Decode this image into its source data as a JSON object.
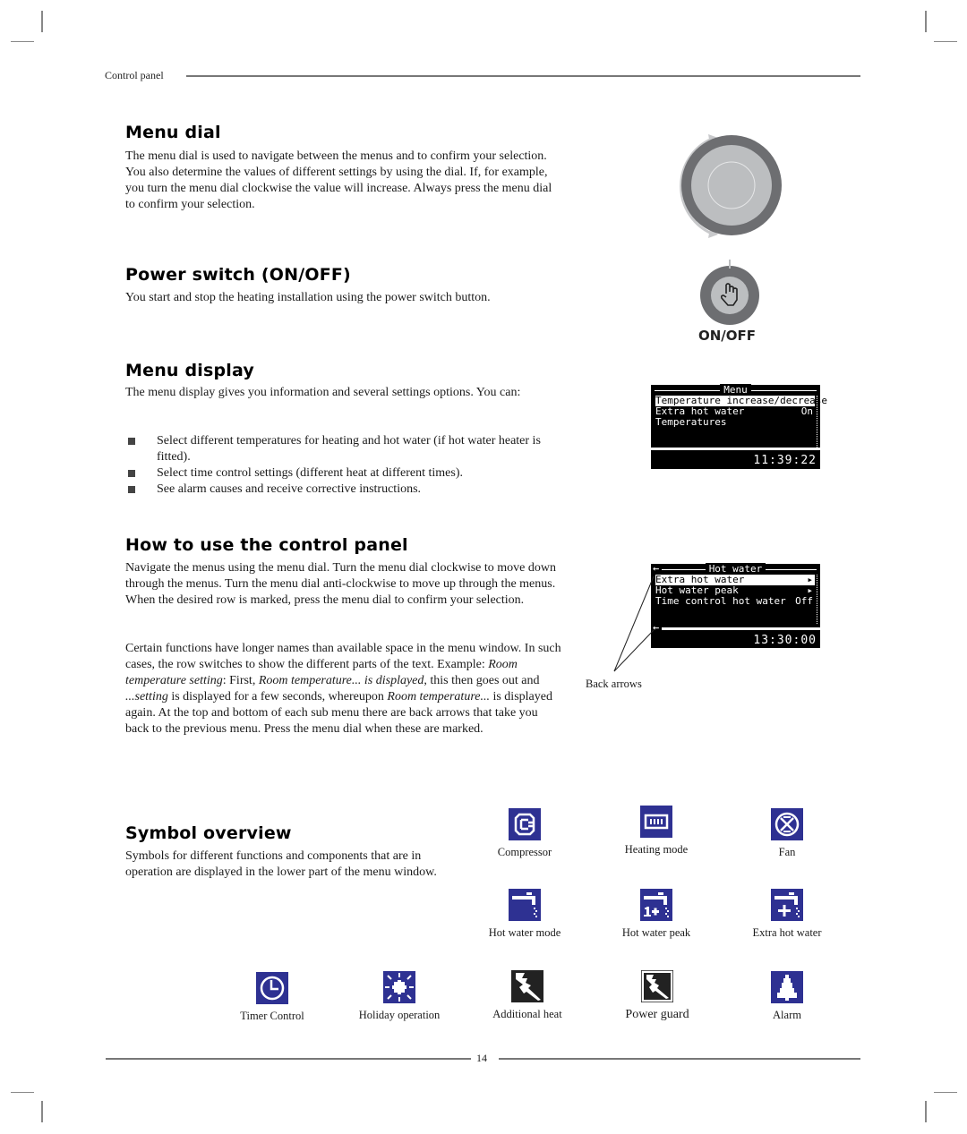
{
  "header": {
    "section": "Control panel"
  },
  "sections": {
    "menu_dial": {
      "title": "Menu dial",
      "body": "The menu dial is used to navigate between the menus and to confirm your selection. You also determine the values of different settings by using the dial. If, for example, you turn the menu dial clockwise the value will increase. Always press the menu dial to confirm your selection."
    },
    "power_switch": {
      "title": "Power switch (ON/OFF)",
      "body": "You start and stop the heating installation using the power switch button.",
      "button_label": "ON/OFF"
    },
    "menu_display": {
      "title": "Menu display",
      "body": "The menu display gives you information and several settings options. You can:",
      "bullets": [
        "Select different temperatures for heating and hot water (if hot water heater is fitted).",
        "Select time control settings (different heat at different times).",
        "See alarm causes and receive corrective instructions."
      ],
      "screen": {
        "title": "Menu",
        "rows": [
          {
            "label": "Temperature increase/decrease",
            "value": "",
            "selected": true
          },
          {
            "label": "Extra hot water",
            "value": "On",
            "selected": false
          },
          {
            "label": "Temperatures",
            "value": "",
            "selected": false
          }
        ],
        "time": "11:39:22"
      }
    },
    "how_to_use": {
      "title": "How to use the control panel",
      "para1": "Navigate the menus using the menu dial. Turn the menu dial clockwise to move down through the menus. Turn the menu dial anti-clockwise to move up through the menus. When the desired row is marked, press the menu dial to confirm your selection.",
      "para2_parts": {
        "a": "Certain functions have longer names than available space in the menu window. In such cases, the row switches to show the different parts of the text. Example: ",
        "b_italic": "Room temperature setting",
        "c": ": First, ",
        "d_italic": "Room temperature... is displayed",
        "e": ", this then goes out and ",
        "f_italic": "...setting",
        "g": " is displayed for a few seconds, whereupon ",
        "h_italic": "Room temperature...",
        "i": " is displayed again. At the top and bottom of each sub menu there are back arrows that take you back to the previous menu. Press the menu dial when these are marked."
      },
      "screen": {
        "title": "Hot water",
        "rows": [
          {
            "label": "Extra hot water",
            "value": "▸",
            "selected": true
          },
          {
            "label": "Hot water peak",
            "value": "▸",
            "selected": false
          },
          {
            "label": "Time control hot water",
            "value": "Off",
            "selected": false
          }
        ],
        "time": "13:30:00",
        "back_arrow": "←"
      },
      "callout": "Back arrows"
    },
    "symbol_overview": {
      "title": "Symbol overview",
      "body": "Symbols for different functions and components that are in operation are displayed in the lower part of the menu window.",
      "symbols": [
        {
          "icon": "compressor-icon",
          "label": "Compressor"
        },
        {
          "icon": "heating-mode-icon",
          "label": "Heating mode"
        },
        {
          "icon": "fan-icon",
          "label": "Fan"
        },
        {
          "icon": "hot-water-mode-icon",
          "label": "Hot water mode"
        },
        {
          "icon": "hot-water-peak-icon",
          "label": "Hot water peak"
        },
        {
          "icon": "extra-hot-water-icon",
          "label": "Extra hot water"
        },
        {
          "icon": "timer-control-icon",
          "label": "Timer Control"
        },
        {
          "icon": "holiday-operation-icon",
          "label": "Holiday operation"
        },
        {
          "icon": "additional-heat-icon",
          "label": "Additional heat"
        },
        {
          "icon": "power-guard-icon",
          "label": "Power guard"
        },
        {
          "icon": "alarm-icon",
          "label": "Alarm"
        }
      ]
    }
  },
  "footer": {
    "page_number": "14"
  },
  "colors": {
    "symbol_blue": "#2e3192",
    "dial_dark": "#6d6e71",
    "dial_light": "#bcbec0"
  }
}
